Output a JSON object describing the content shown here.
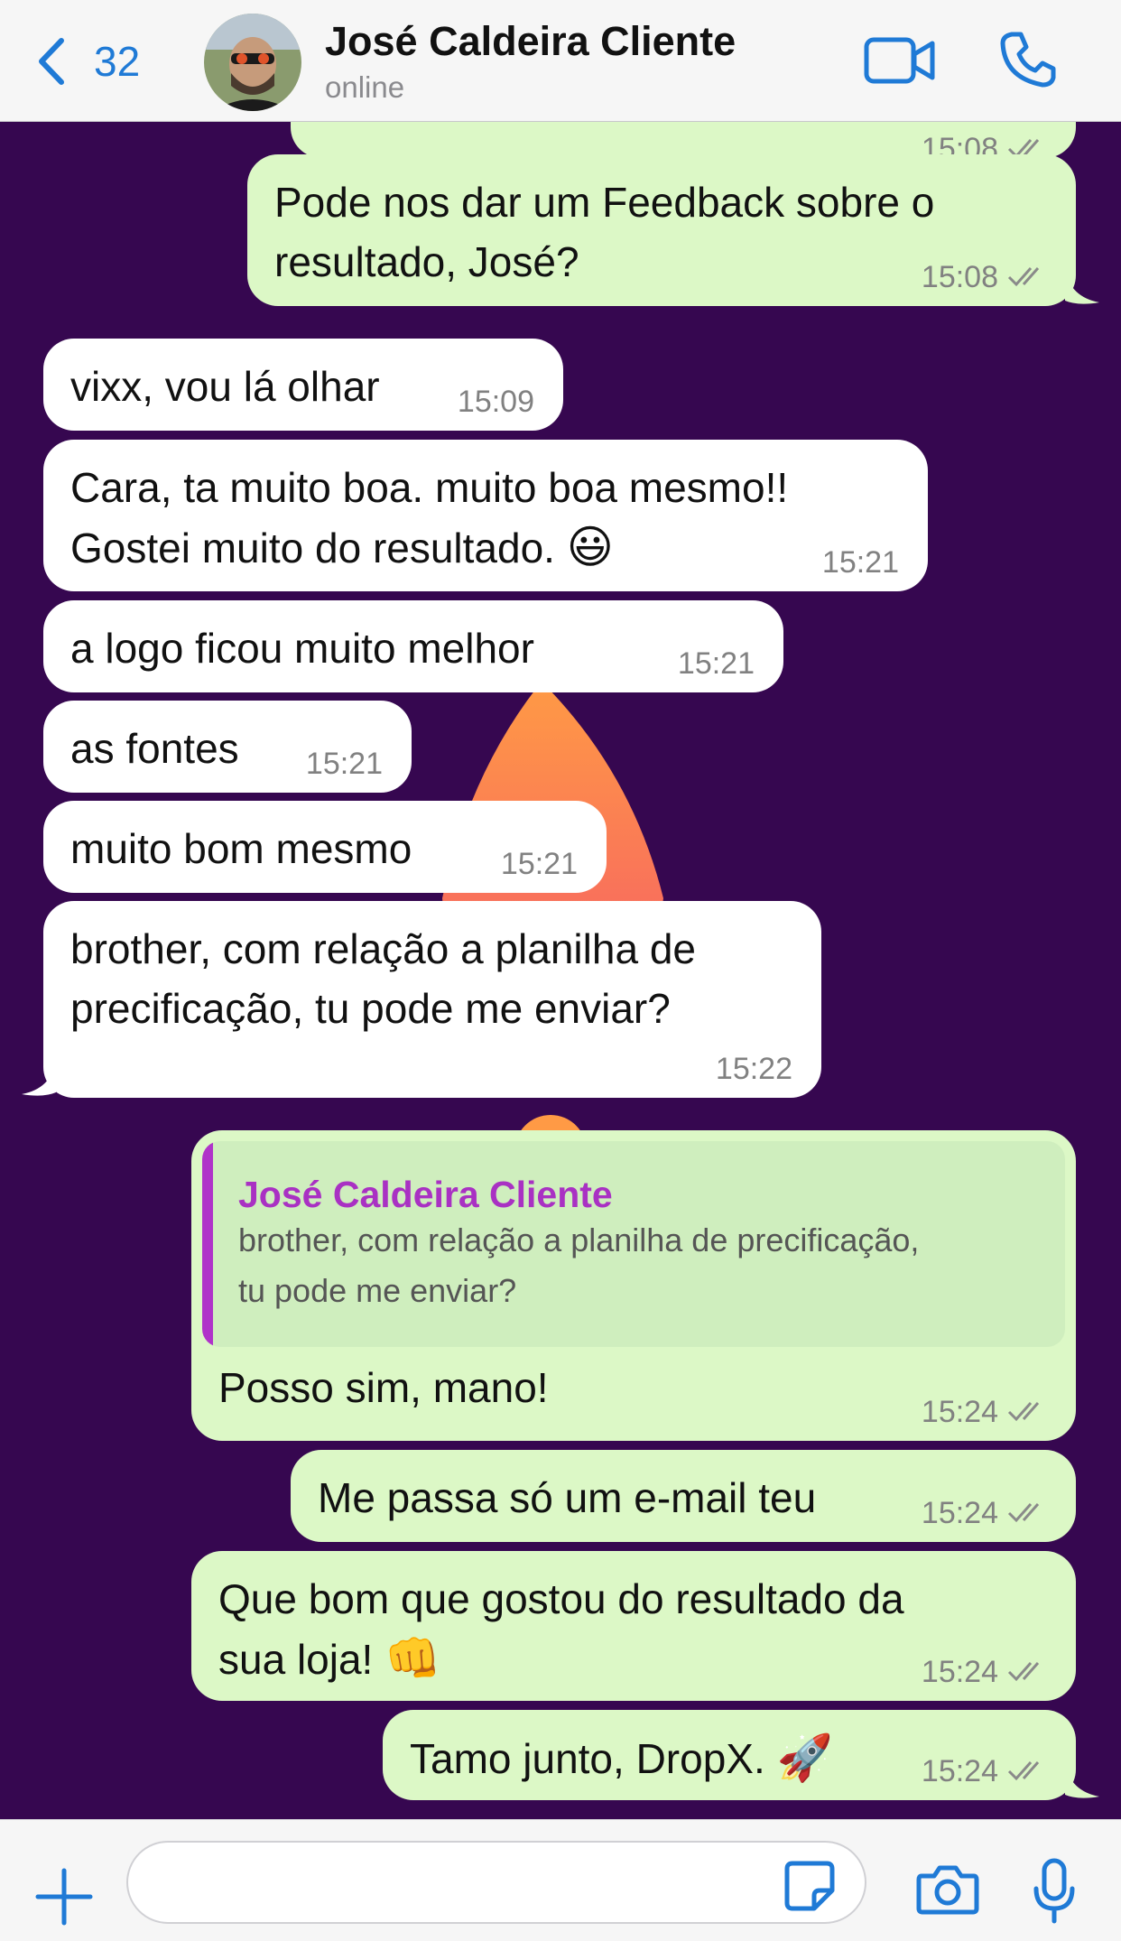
{
  "header": {
    "back_count": "32",
    "contact_name": "José Caldeira Cliente",
    "status": "online",
    "icons": [
      "chevron-left-icon",
      "video-call-icon",
      "phone-icon"
    ],
    "accent_color": "#1f7ad6"
  },
  "chat": {
    "background_color": "#360750",
    "partial_top_time": "15:08",
    "messages": [
      {
        "dir": "out",
        "lines": [
          "Pode nos dar um Feedback sobre o",
          "resultado, José?"
        ],
        "time": "15:08"
      },
      {
        "dir": "in",
        "lines": [
          "vixx, vou lá olhar"
        ],
        "time": "15:09"
      },
      {
        "dir": "in",
        "lines": [
          "Cara, ta muito boa. muito boa mesmo!!",
          "Gostei muito do resultado."
        ],
        "emoji": "😃",
        "time": "15:21"
      },
      {
        "dir": "in",
        "lines": [
          "a logo ficou muito melhor"
        ],
        "time": "15:21"
      },
      {
        "dir": "in",
        "lines": [
          "as fontes"
        ],
        "time": "15:21"
      },
      {
        "dir": "in",
        "lines": [
          "muito bom mesmo"
        ],
        "time": "15:21"
      },
      {
        "dir": "in",
        "lines": [
          "brother, com relação a planilha de",
          "precificação, tu pode me enviar?"
        ],
        "time": "15:22"
      },
      {
        "dir": "out",
        "quote": {
          "author": "José Caldeira Cliente",
          "lines": [
            "brother, com relação a planilha de precificação,",
            "tu pode me enviar?"
          ]
        },
        "lines": [
          "Posso sim, mano!"
        ],
        "time": "15:24"
      },
      {
        "dir": "out",
        "lines": [
          "Me passa só um e-mail teu"
        ],
        "time": "15:24"
      },
      {
        "dir": "out",
        "lines": [
          "Que bom que gostou do resultado da",
          "sua loja!"
        ],
        "emoji": "👊",
        "time": "15:24"
      },
      {
        "dir": "out",
        "lines": [
          "Tamo junto, DropX."
        ],
        "emoji": "🚀",
        "time": "15:24"
      }
    ]
  },
  "input_bar": {
    "placeholder": "",
    "icons": [
      "plus-icon",
      "sticker-icon",
      "camera-icon",
      "microphone-icon"
    ]
  }
}
